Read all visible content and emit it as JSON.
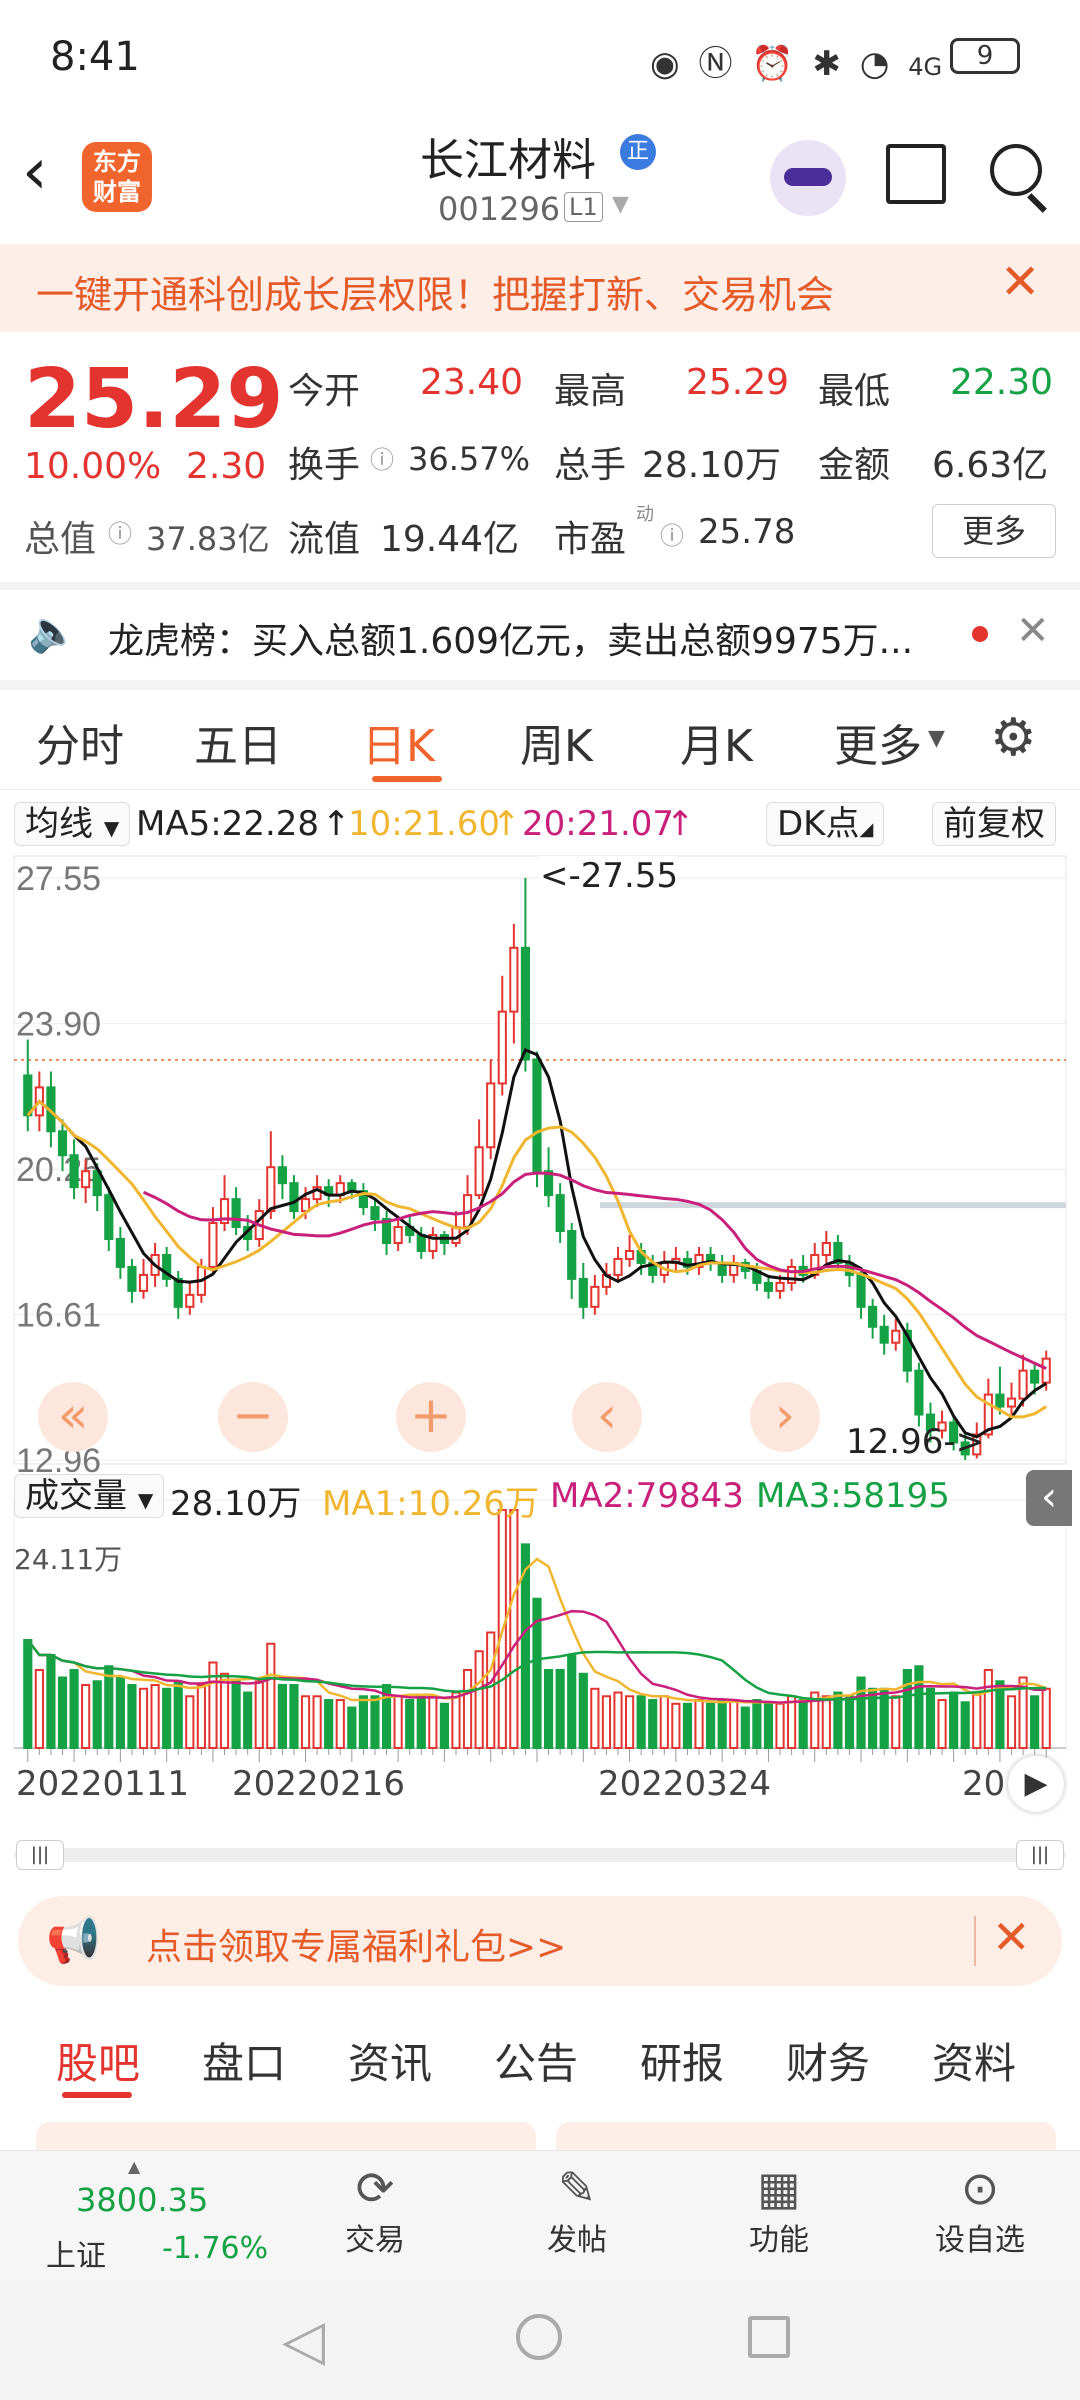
{
  "status": {
    "time": "8:41",
    "battery": "9",
    "network": "4G"
  },
  "header": {
    "title": "长江材料",
    "title_badge": "正",
    "code": "001296",
    "level": "L1",
    "logo_line1": "东方",
    "logo_line2": "财富"
  },
  "promo": {
    "text": "一键开通科创成长层权限！把握打新、交易机会"
  },
  "quote": {
    "price": "25.29",
    "change_pct": "10.00%",
    "change_abs": "2.30",
    "open_label": "今开",
    "open": "23.40",
    "high_label": "最高",
    "high": "25.29",
    "low_label": "最低",
    "low": "22.30",
    "turnover_label": "换手",
    "turnover": "36.57%",
    "volume_label": "总手",
    "volume": "28.10万",
    "amount_label": "金额",
    "amount": "6.63亿",
    "mktcap_label": "总值",
    "mktcap": "37.83亿",
    "float_label": "流值",
    "float": "19.44亿",
    "pe_label": "市盈",
    "pe_sup": "动",
    "pe": "25.78",
    "more": "更多"
  },
  "news": {
    "text": "龙虎榜：买入总额1.609亿元，卖出总额9975万..."
  },
  "tabs": [
    "分时",
    "五日",
    "日K",
    "周K",
    "月K",
    "更多"
  ],
  "active_tab": "日K",
  "ma_bar": {
    "type": "均线",
    "ma5": "MA5:22.28",
    "ma10": "10:21.60",
    "ma20": "20:21.07",
    "dk": "DK点",
    "adj": "前复权"
  },
  "price_axis": [
    "27.55",
    "23.90",
    "20.25",
    "16.61",
    "12.96"
  ],
  "annotations": {
    "high": "<-27.55",
    "low": "12.96->"
  },
  "vol_bar": {
    "label": "成交量",
    "vol": "28.10万",
    "ma1": "MA1:10.26万",
    "ma2": "MA2:79843",
    "ma3": "MA3:58195",
    "max": "24.11万"
  },
  "dates": [
    "20220111",
    "20220216",
    "20220324",
    "20"
  ],
  "colors": {
    "up": "#e3342f",
    "down": "#15a245",
    "ma5": "#111111",
    "ma10": "#f1b630",
    "ma20": "#c8207b",
    "accent": "#f0652d"
  },
  "banner": {
    "text": "点击领取专属福利礼包>>"
  },
  "bottom_tabs": [
    "股吧",
    "盘口",
    "资讯",
    "公告",
    "研报",
    "财务",
    "资料"
  ],
  "dock": {
    "index_value": "3800.35",
    "index_name": "上证",
    "index_change": "-1.76%",
    "trade": "交易",
    "post": "发帖",
    "func": "功能",
    "watch": "设自选"
  },
  "chart_data": {
    "type": "candlestick",
    "x_ticks": [
      "20220111",
      "20220216",
      "20220324"
    ],
    "ylim": [
      12.96,
      27.55
    ],
    "y_ticks": [
      27.55,
      23.9,
      20.25,
      16.61,
      12.96
    ],
    "candles": [
      [
        22.6,
        21.6,
        23.5,
        21.2
      ],
      [
        21.6,
        22.3,
        22.7,
        21.2
      ],
      [
        22.3,
        21.2,
        22.7,
        20.8
      ],
      [
        21.2,
        20.6,
        21.5,
        20.2
      ],
      [
        20.6,
        19.8,
        21.0,
        19.5
      ],
      [
        19.8,
        20.2,
        20.5,
        19.4
      ],
      [
        20.2,
        19.6,
        20.4,
        19.2
      ],
      [
        19.6,
        18.5,
        19.8,
        18.2
      ],
      [
        18.5,
        17.8,
        18.8,
        17.5
      ],
      [
        17.8,
        17.2,
        18.0,
        16.9
      ],
      [
        17.2,
        17.6,
        18.0,
        17.0
      ],
      [
        17.6,
        18.1,
        18.4,
        17.3
      ],
      [
        18.1,
        17.5,
        18.3,
        17.3
      ],
      [
        17.5,
        16.8,
        17.7,
        16.5
      ],
      [
        16.8,
        17.1,
        17.4,
        16.6
      ],
      [
        17.1,
        17.8,
        18.0,
        16.9
      ],
      [
        17.8,
        18.9,
        19.3,
        17.6
      ],
      [
        18.9,
        19.5,
        20.1,
        18.7
      ],
      [
        19.5,
        18.8,
        19.8,
        18.6
      ],
      [
        18.8,
        18.5,
        19.1,
        18.2
      ],
      [
        18.5,
        19.2,
        19.5,
        18.3
      ],
      [
        19.2,
        20.3,
        21.2,
        19.0
      ],
      [
        20.3,
        19.9,
        20.6,
        19.5
      ],
      [
        19.9,
        19.2,
        20.1,
        19.0
      ],
      [
        19.2,
        19.5,
        19.8,
        19.0
      ],
      [
        19.5,
        19.8,
        20.1,
        19.3
      ],
      [
        19.8,
        19.6,
        20.0,
        19.3
      ],
      [
        19.6,
        19.9,
        20.1,
        19.4
      ],
      [
        19.9,
        19.7,
        20.0,
        19.5
      ],
      [
        19.7,
        19.3,
        19.9,
        19.1
      ],
      [
        19.3,
        19.0,
        19.5,
        18.7
      ],
      [
        19.0,
        18.4,
        19.2,
        18.1
      ],
      [
        18.4,
        18.8,
        19.0,
        18.2
      ],
      [
        18.8,
        18.6,
        19.1,
        18.4
      ],
      [
        18.6,
        18.2,
        18.8,
        18.0
      ],
      [
        18.2,
        18.6,
        18.8,
        18.0
      ],
      [
        18.6,
        18.4,
        18.7,
        18.1
      ],
      [
        18.4,
        18.8,
        19.2,
        18.3
      ],
      [
        18.8,
        19.6,
        20.1,
        18.6
      ],
      [
        19.6,
        20.8,
        21.5,
        19.5
      ],
      [
        20.8,
        22.4,
        23.0,
        20.5
      ],
      [
        22.4,
        24.2,
        25.1,
        22.1
      ],
      [
        24.2,
        25.8,
        26.4,
        23.4
      ],
      [
        25.8,
        23.0,
        27.55,
        22.7
      ],
      [
        23.0,
        20.2,
        23.2,
        19.8
      ],
      [
        20.2,
        19.6,
        20.8,
        19.3
      ],
      [
        19.6,
        18.7,
        19.9,
        18.4
      ],
      [
        18.7,
        17.5,
        18.9,
        17.0
      ],
      [
        17.5,
        16.8,
        17.9,
        16.5
      ],
      [
        16.8,
        17.3,
        17.6,
        16.6
      ],
      [
        17.3,
        17.6,
        17.9,
        17.1
      ],
      [
        17.6,
        18.0,
        18.3,
        17.4
      ],
      [
        18.0,
        18.2,
        18.6,
        17.8
      ],
      [
        18.2,
        17.9,
        18.4,
        17.6
      ],
      [
        17.9,
        17.6,
        18.1,
        17.4
      ],
      [
        17.6,
        17.9,
        18.2,
        17.4
      ],
      [
        17.9,
        18.0,
        18.3,
        17.7
      ],
      [
        18.0,
        17.8,
        18.2,
        17.6
      ],
      [
        17.8,
        18.1,
        18.3,
        17.6
      ],
      [
        18.1,
        17.9,
        18.3,
        17.7
      ],
      [
        17.9,
        17.6,
        18.1,
        17.4
      ],
      [
        17.6,
        17.9,
        18.1,
        17.4
      ],
      [
        17.9,
        17.7,
        18.0,
        17.5
      ],
      [
        17.7,
        17.4,
        17.9,
        17.2
      ],
      [
        17.4,
        17.2,
        17.6,
        17.0
      ],
      [
        17.2,
        17.4,
        17.6,
        17.0
      ],
      [
        17.4,
        17.8,
        18.0,
        17.2
      ],
      [
        17.8,
        17.6,
        18.1,
        17.4
      ],
      [
        17.6,
        18.1,
        18.4,
        17.5
      ],
      [
        18.1,
        18.4,
        18.7,
        17.9
      ],
      [
        18.4,
        17.9,
        18.6,
        17.7
      ],
      [
        17.9,
        17.6,
        18.1,
        17.3
      ],
      [
        17.6,
        16.8,
        17.8,
        16.5
      ],
      [
        16.8,
        16.3,
        17.0,
        16.0
      ],
      [
        16.3,
        15.9,
        16.6,
        15.6
      ],
      [
        15.9,
        16.2,
        16.5,
        15.7
      ],
      [
        16.2,
        15.2,
        16.4,
        14.9
      ],
      [
        15.2,
        14.1,
        15.4,
        13.8
      ],
      [
        14.1,
        13.7,
        14.4,
        13.4
      ],
      [
        13.7,
        13.9,
        14.2,
        13.5
      ],
      [
        13.9,
        13.4,
        14.1,
        13.2
      ],
      [
        13.4,
        13.1,
        13.6,
        12.96
      ],
      [
        13.1,
        13.6,
        13.9,
        13.0
      ],
      [
        13.6,
        14.6,
        15.0,
        13.5
      ],
      [
        14.6,
        14.3,
        15.3,
        14.1
      ],
      [
        14.3,
        14.5,
        14.9,
        14.1
      ],
      [
        14.5,
        15.2,
        15.6,
        14.3
      ],
      [
        15.2,
        14.9,
        15.4,
        14.6
      ],
      [
        14.9,
        15.5,
        15.7,
        14.7
      ]
    ],
    "volume_ylim": [
      0,
      24.11
    ],
    "volume_unit": "万",
    "series": [
      {
        "name": "MA5",
        "values": [
          22.28
        ]
      },
      {
        "name": "10",
        "values": [
          21.6
        ]
      },
      {
        "name": "20",
        "values": [
          21.07
        ]
      }
    ]
  }
}
